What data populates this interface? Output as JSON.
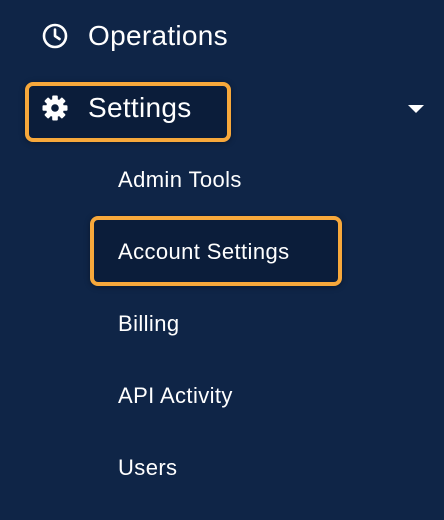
{
  "nav": {
    "operations": {
      "label": "Operations",
      "icon": "clock-icon"
    },
    "settings": {
      "label": "Settings",
      "icon": "gear-icon",
      "expanded": true,
      "submenu": [
        {
          "label": "Admin Tools"
        },
        {
          "label": "Account Settings"
        },
        {
          "label": "Billing"
        },
        {
          "label": "API Activity"
        },
        {
          "label": "Users"
        }
      ]
    }
  },
  "colors": {
    "background": "#0f2547",
    "highlight_border": "#f7a83b",
    "text": "#ffffff"
  }
}
